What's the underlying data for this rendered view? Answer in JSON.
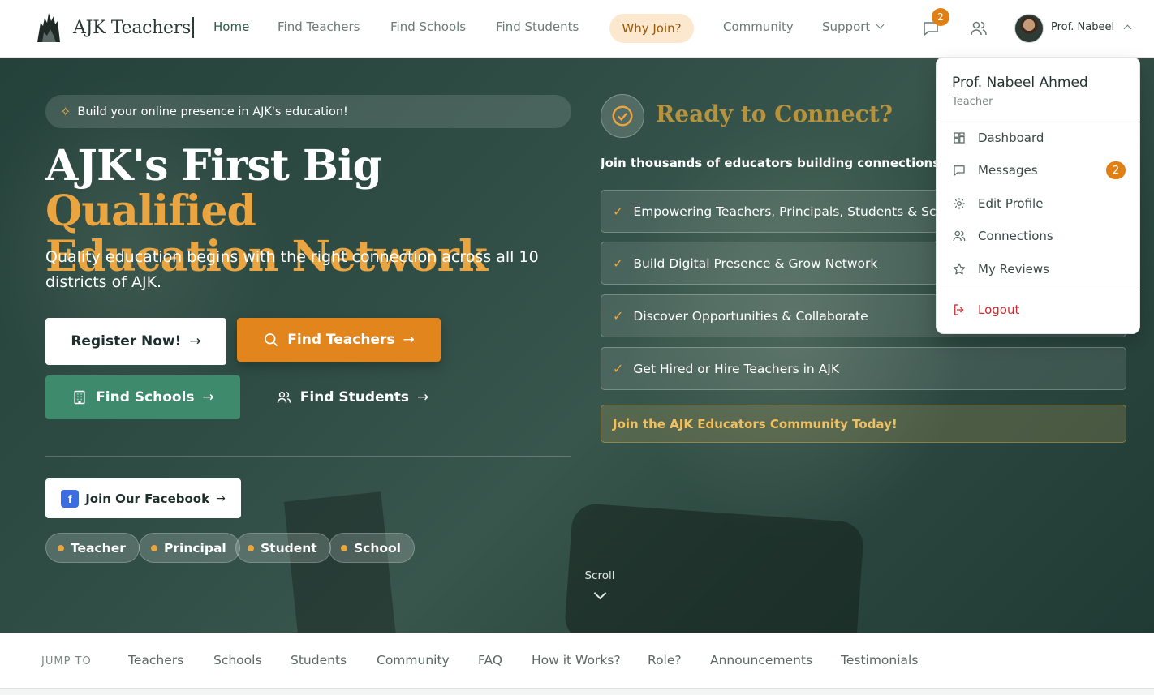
{
  "brand": {
    "name": "AJK Teachers"
  },
  "nav": {
    "home": "Home",
    "find_teachers": "Find Teachers",
    "find_schools": "Find Schools",
    "find_students": "Find Students",
    "why_join": "Why Join?",
    "community": "Community",
    "support": "Support",
    "messages_count": "2",
    "user_short_name": "Prof. Nabeel"
  },
  "hero": {
    "pill": "Build your online presence in AJK's education!",
    "headline_white": "AJK's First Big ",
    "headline_gold_1": "Qualified",
    "headline_gold_2": "Education Network",
    "subtext": "Quality education begins with the right connection across all 10 districts of AJK.",
    "register": "Register Now!",
    "find_teachers": "Find Teachers",
    "find_schools": "Find Schools",
    "find_students": "Find Students",
    "facebook": "Join Our Facebook",
    "roles": [
      "Teacher",
      "Principal",
      "Student",
      "School"
    ],
    "scroll": "Scroll"
  },
  "panel": {
    "title": "Ready to Connect?",
    "join_line": "Join thousands of educators building connections across AJK",
    "features": [
      "Empowering Teachers, Principals, Students & Schools",
      "Build Digital Presence & Grow Network",
      "Discover Opportunities & Collaborate",
      "Get Hired or Hire Teachers in AJK"
    ],
    "community": "Join the AJK Educators Community Today!"
  },
  "dropdown": {
    "name": "Prof. Nabeel Ahmed",
    "role": "Teacher",
    "dashboard": "Dashboard",
    "messages": "Messages",
    "messages_count": "2",
    "edit_profile": "Edit Profile",
    "connections": "Connections",
    "reviews": "My Reviews",
    "logout": "Logout"
  },
  "jump": {
    "label": "JUMP TO",
    "links": [
      "Teachers",
      "Schools",
      "Students",
      "Community",
      "FAQ",
      "How it Works?",
      "Role?",
      "Announcements",
      "Testimonials"
    ]
  },
  "colors": {
    "accent_orange": "#e2851d",
    "accent_gold": "#eaa540",
    "brand_green": "#3d8a6c",
    "hero_dark": "#2f4d45",
    "logout_red": "#d0282f"
  },
  "icons": [
    "spark-icon",
    "check-circle-icon",
    "chat-icon",
    "users-icon",
    "search-icon",
    "building-icon",
    "facebook-icon",
    "dashboard-icon",
    "message-icon",
    "gear-icon",
    "star-icon",
    "logout-icon"
  ]
}
